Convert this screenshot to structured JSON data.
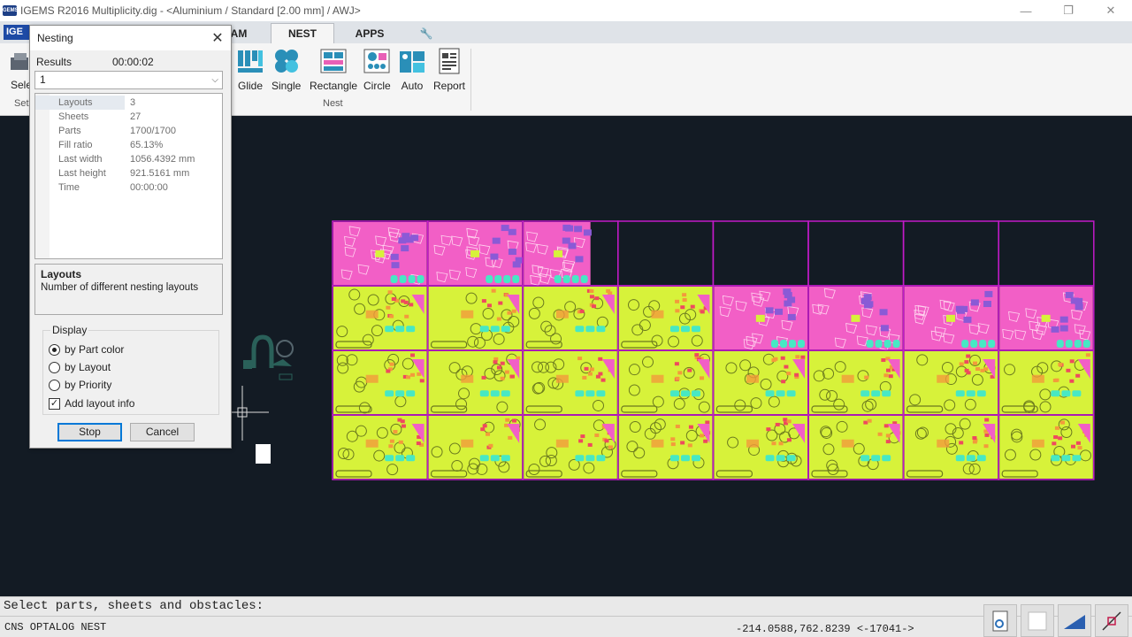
{
  "window": {
    "title": "IGEMS R2016  Multiplicity.dig - <Aluminium / Standard [2.00 mm] / AWJ>",
    "badge": "IGEMS",
    "minimize": "—",
    "restore": "❐",
    "close": "✕"
  },
  "ribbon": {
    "logo": "IGE",
    "tabs": [
      {
        "label": "AM"
      },
      {
        "label": "NEST"
      },
      {
        "label": "APPS"
      },
      {
        "label": "🔧"
      }
    ],
    "left_button_label": "Sele",
    "left_group_label": "Set",
    "buttons": [
      {
        "label": "Glide",
        "icon": "glide-icon"
      },
      {
        "label": "Single",
        "icon": "single-icon"
      },
      {
        "label": "Rectangle",
        "icon": "rectangle-icon"
      },
      {
        "label": "Circle",
        "icon": "circle-icon"
      },
      {
        "label": "Auto",
        "icon": "auto-icon"
      },
      {
        "label": "Report",
        "icon": "report-icon"
      }
    ],
    "group_label": "Nest"
  },
  "dialog": {
    "title": "Nesting",
    "close": "✕",
    "results_label": "Results",
    "results_time": "00:00:02",
    "combo_value": "1",
    "properties": [
      {
        "key": "Layouts",
        "value": "3"
      },
      {
        "key": "Sheets",
        "value": "27"
      },
      {
        "key": "Parts",
        "value": "1700/1700"
      },
      {
        "key": "Fill ratio",
        "value": "65.13%"
      },
      {
        "key": "Last width",
        "value": "1056.4392 mm"
      },
      {
        "key": "Last height",
        "value": "921.5161 mm"
      },
      {
        "key": "Time",
        "value": "00:00:00"
      }
    ],
    "help_title": "Layouts",
    "help_desc": "Number of different nesting layouts",
    "display_label": "Display",
    "options": [
      {
        "label": "by Part color",
        "selected": true
      },
      {
        "label": "by Layout",
        "selected": false
      },
      {
        "label": "by Priority",
        "selected": false
      }
    ],
    "add_layout_info_label": "Add layout info",
    "add_layout_info_checked": true,
    "check_mark": "✓",
    "stop_label": "Stop",
    "cancel_label": "Cancel"
  },
  "command": {
    "prompt": "Select parts, sheets and obstacles:"
  },
  "status": {
    "left": "CNS OPTALOG NEST",
    "coords": "-214.0588,762.8239 <-17041->"
  },
  "nest_view": {
    "rows": 4,
    "cols": 8,
    "empty_sheets_row1": 5,
    "colors": {
      "background": "#131b24",
      "sheet_border": "#c21ac8",
      "pink": "#f25fc6",
      "purple": "#8a5ad6",
      "yellow_green": "#d7f23a",
      "cyan": "#47e8c4",
      "orange": "#f39a3c",
      "red": "#ee4a5e"
    }
  }
}
